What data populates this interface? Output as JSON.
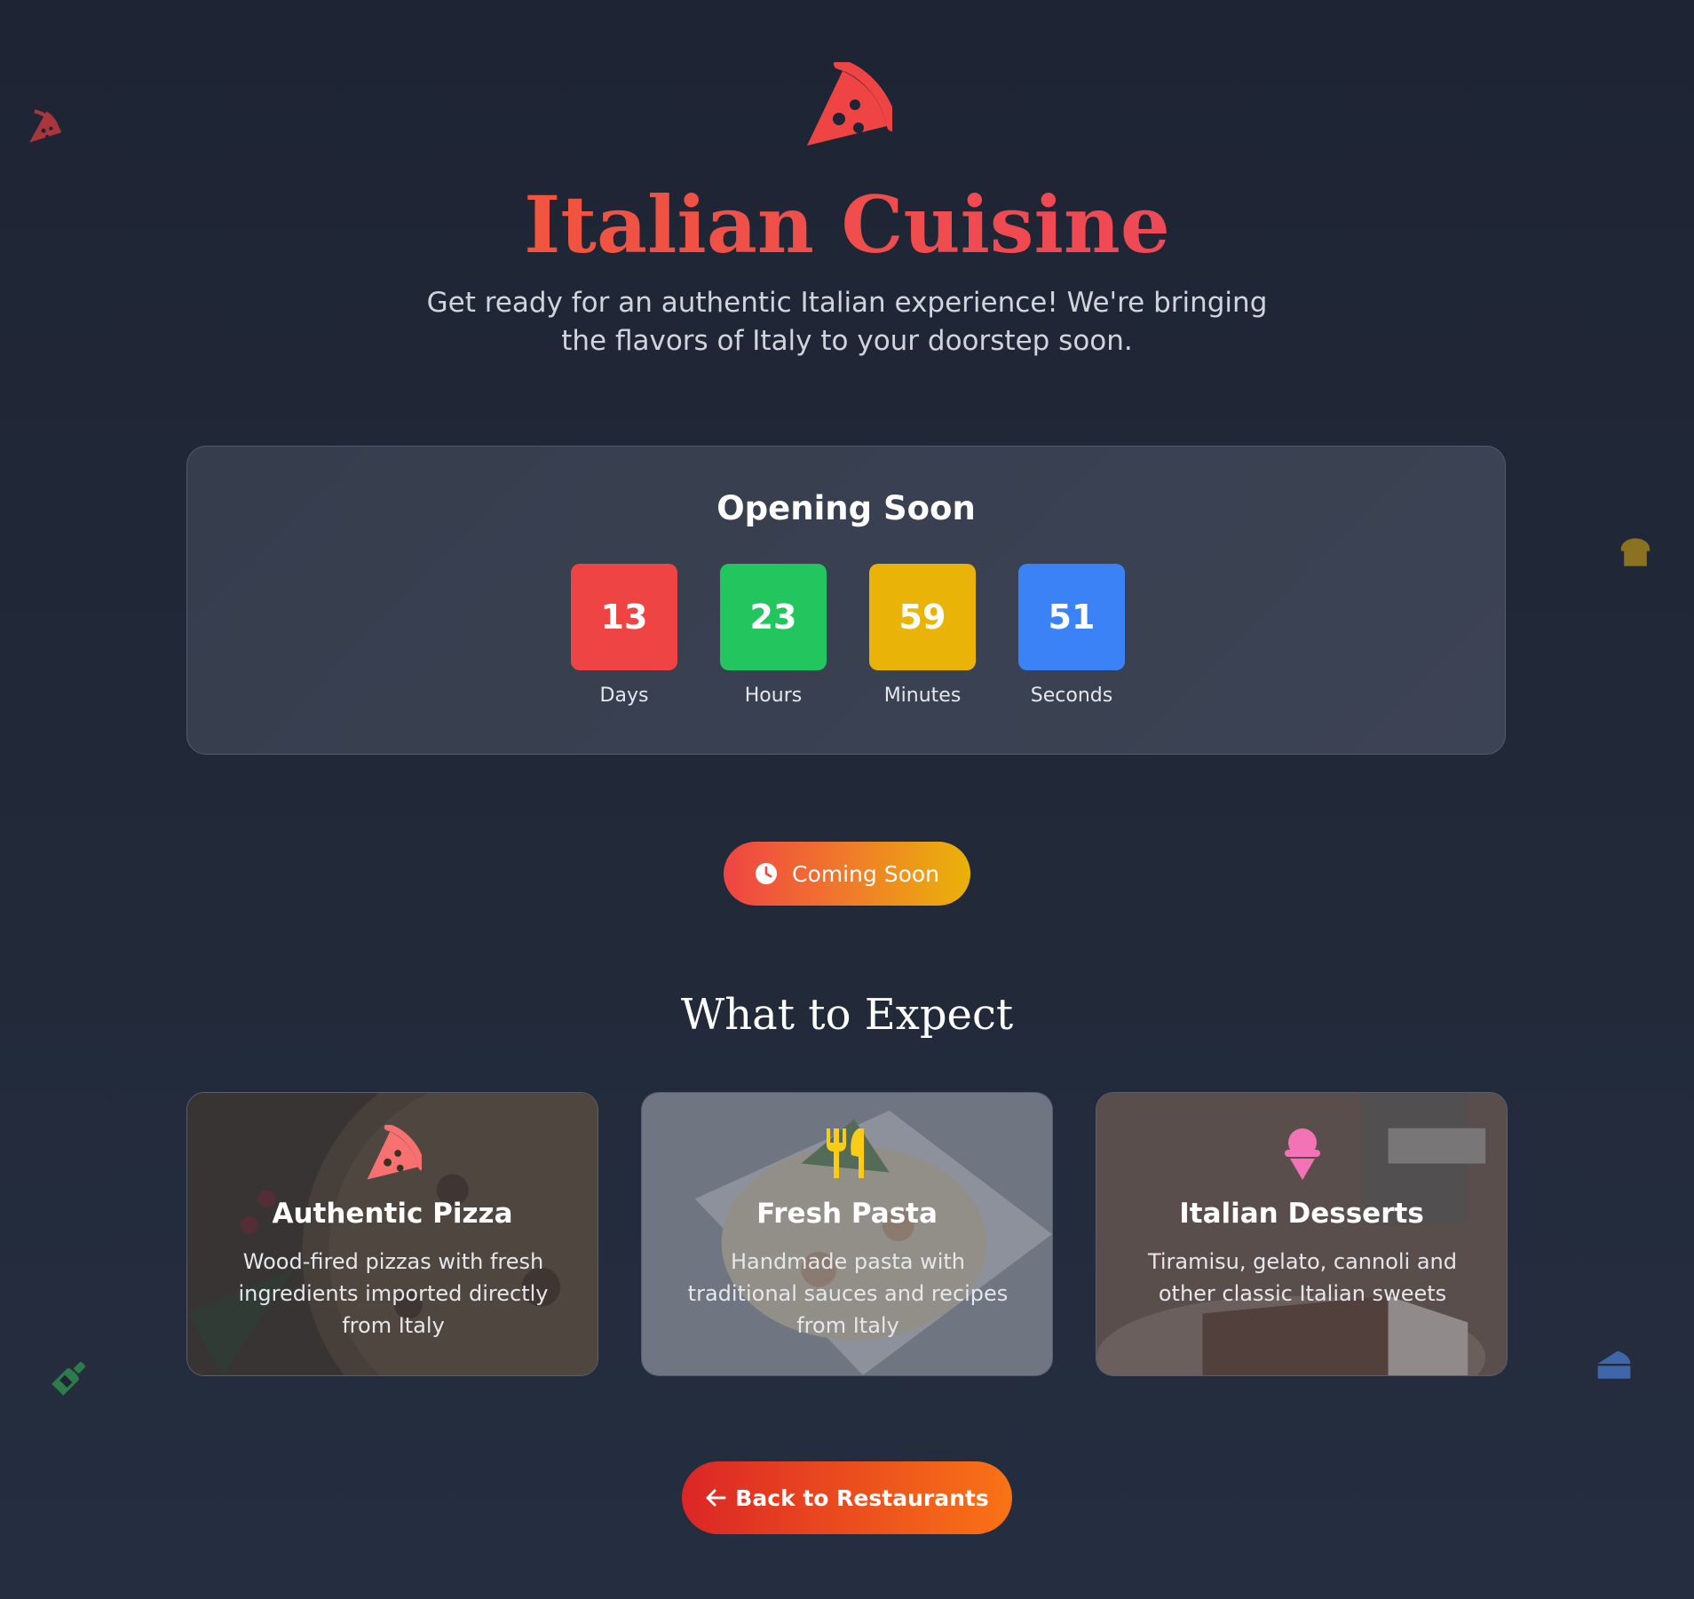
{
  "header": {
    "icon": "pizza-slice-icon",
    "title": "Italian Cuisine",
    "subtitle": "Get ready for an authentic Italian experience! We're bringing the flavors of Italy to your doorstep soon."
  },
  "countdown": {
    "title": "Opening Soon",
    "units": [
      {
        "value": "13",
        "label": "Days",
        "color": "#ef4444"
      },
      {
        "value": "23",
        "label": "Hours",
        "color": "#22c55e"
      },
      {
        "value": "59",
        "label": "Minutes",
        "color": "#eab308"
      },
      {
        "value": "51",
        "label": "Seconds",
        "color": "#3b82f6"
      }
    ]
  },
  "status_pill": {
    "icon": "clock-icon",
    "label": "Coming Soon"
  },
  "expect": {
    "title": "What to Expect",
    "features": [
      {
        "icon": "pizza-slice-icon",
        "title": "Authentic Pizza",
        "description": "Wood-fired pizzas with fresh ingredients imported directly from Italy"
      },
      {
        "icon": "utensils-icon",
        "title": "Fresh Pasta",
        "description": "Handmade pasta with traditional sauces and recipes from Italy"
      },
      {
        "icon": "ice-cream-icon",
        "title": "Italian Desserts",
        "description": "Tiramisu, gelato, cannoli and other classic Italian sweets"
      }
    ]
  },
  "back_button": {
    "icon": "arrow-left-icon",
    "label": "Back to Restaurants"
  },
  "decorations": [
    "pizza-slice-icon",
    "bread-icon",
    "wine-bottle-icon",
    "cheese-icon"
  ],
  "colors": {
    "background": "#1f2535",
    "accent_red": "#ef4444",
    "accent_orange": "#f97316",
    "accent_yellow": "#eab308",
    "accent_green": "#22c55e",
    "accent_blue": "#3b82f6",
    "accent_pink": "#f472b6"
  }
}
